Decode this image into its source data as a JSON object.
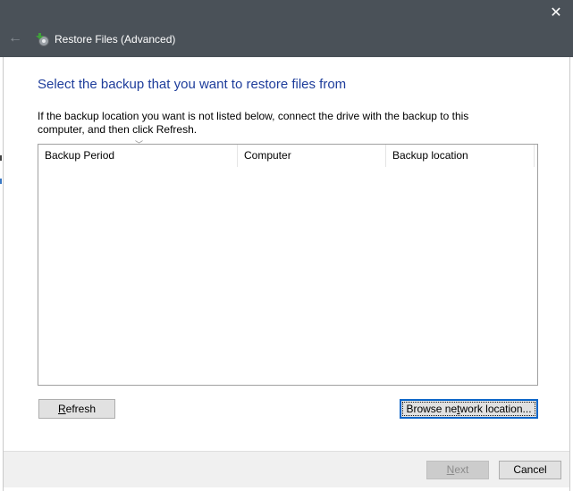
{
  "window": {
    "title": "Restore Files (Advanced)",
    "close_glyph": "✕",
    "back_glyph": "←"
  },
  "page": {
    "heading": "Select the backup that you want to restore files from",
    "instructions": "If the backup location you want is not listed below, connect the drive with the backup to this computer, and then click Refresh."
  },
  "table": {
    "columns": [
      "Backup Period",
      "Computer",
      "Backup location"
    ],
    "rows": []
  },
  "buttons": {
    "refresh": {
      "pre": "",
      "key": "R",
      "post": "efresh"
    },
    "browse": {
      "pre": "Browse ne",
      "key": "t",
      "post": "work location..."
    },
    "next": {
      "pre": "",
      "key": "N",
      "post": "ext"
    },
    "cancel": "Cancel"
  },
  "colors": {
    "titlebar": "#4a5158",
    "heading": "#1e3d9b",
    "focus_border": "#0a64c8"
  }
}
